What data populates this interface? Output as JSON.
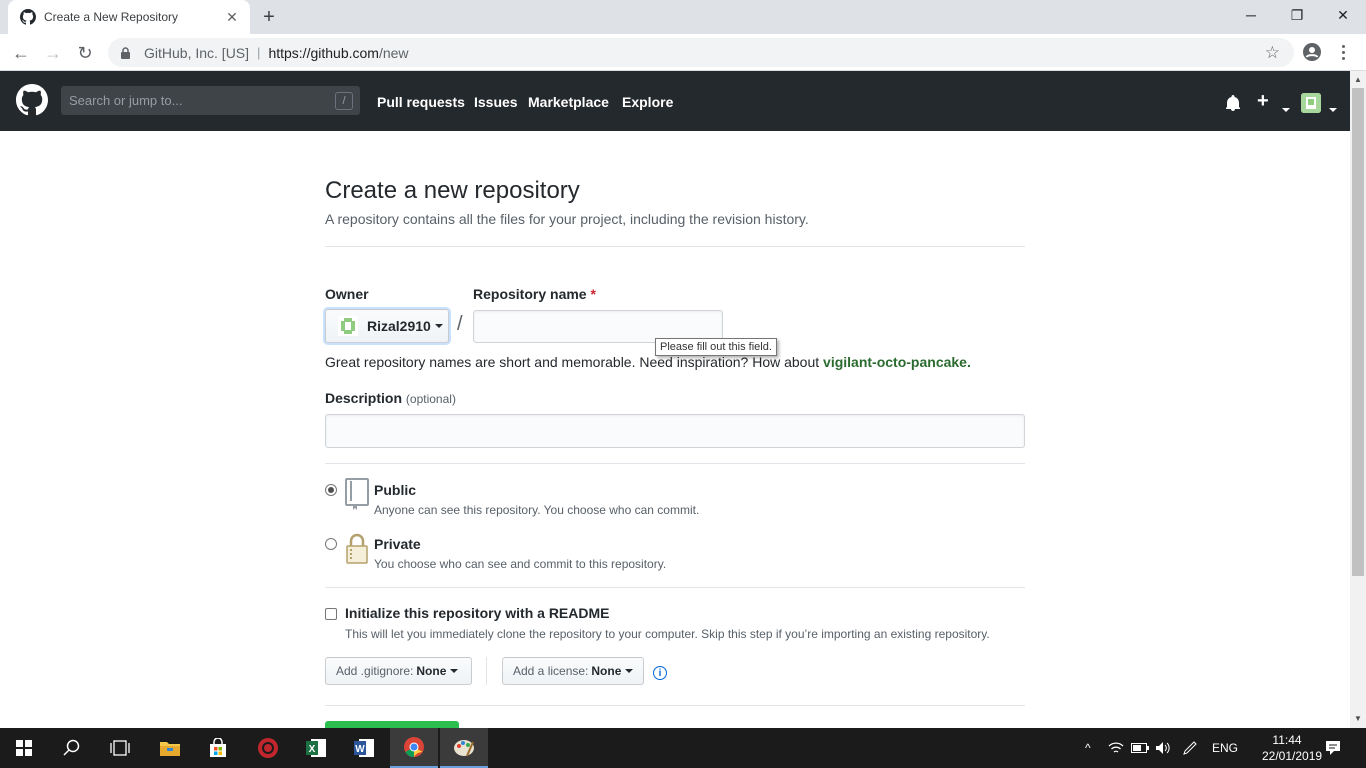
{
  "browser": {
    "tab_title": "Create a New Repository",
    "site_identity": "GitHub, Inc. [US]",
    "url_host": "https://github.com",
    "url_path": "/new"
  },
  "gh_header": {
    "search_placeholder": "Search or jump to...",
    "search_shortcut": "/",
    "nav": [
      "Pull requests",
      "Issues",
      "Marketplace",
      "Explore"
    ],
    "plus": "+"
  },
  "form": {
    "title": "Create a new repository",
    "subtitle": "A repository contains all the files for your project, including the revision history.",
    "owner_label": "Owner",
    "owner_value": "Rizal2910",
    "repo_label": "Repository name",
    "required_mark": "*",
    "slash": "/",
    "tooltip": "Please fill out this field.",
    "hint_prefix": "Great repository names are short and memorable. Need inspiration? How about",
    "hint_suggestion": "vigilant-octo-pancake.",
    "desc_label": "Description",
    "desc_optional": "(optional)",
    "public_title": "Public",
    "public_note": "Anyone can see this repository. You choose who can commit.",
    "private_title": "Private",
    "private_note": "You choose who can see and commit to this repository.",
    "init_title": "Initialize this repository with a README",
    "init_note": "This will let you immediately clone the repository to your computer. Skip this step if you’re importing an existing repository.",
    "gitignore_label": "Add .gitignore:",
    "gitignore_value": "None",
    "license_label": "Add a license:",
    "license_value": "None",
    "info_glyph": "i"
  },
  "taskbar": {
    "lang": "ENG",
    "time": "11:44",
    "date": "22/01/2019"
  },
  "colors": {
    "header_bg": "#24292e",
    "accent_green": "#2cbe4e",
    "taskbar_bg": "#1b1b1b"
  }
}
